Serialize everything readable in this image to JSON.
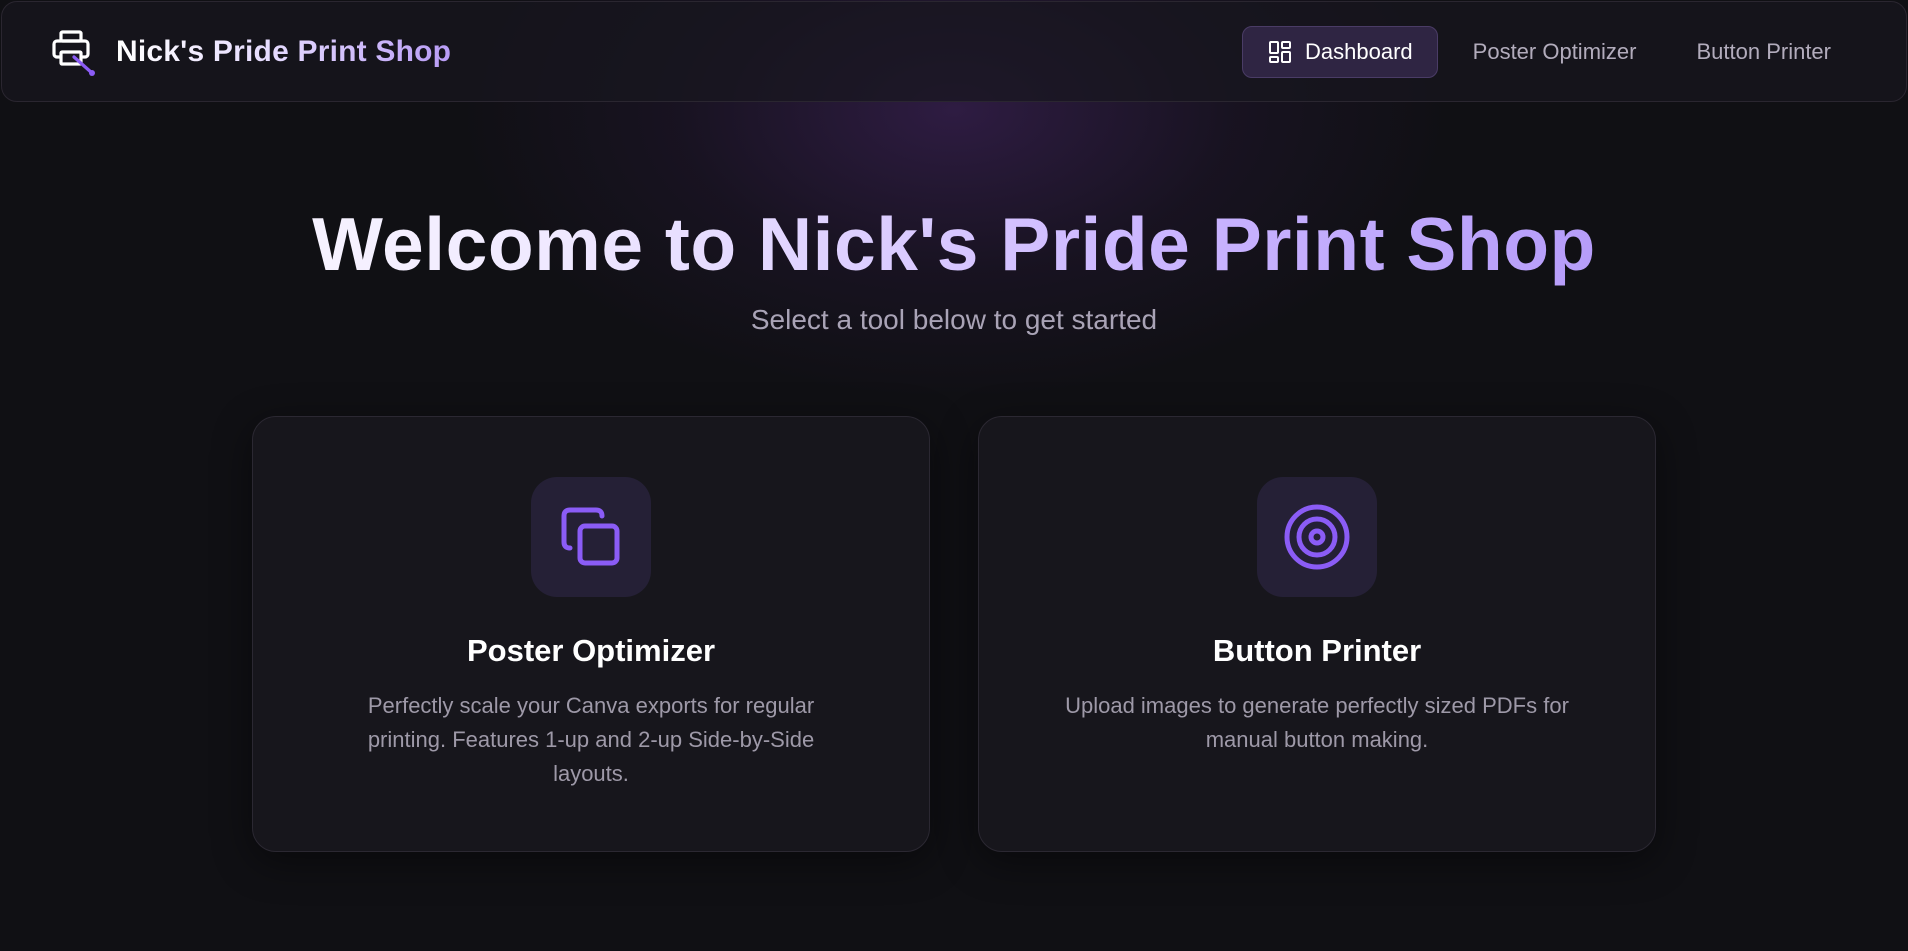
{
  "app": {
    "title_part1": "Nick's Pride ",
    "title_part2": "Print Shop",
    "logo_icon": "printer-icon",
    "accent_color": "#8b5cf6"
  },
  "nav": {
    "items": [
      {
        "label": "Dashboard",
        "icon": "dashboard-grid-icon",
        "active": true
      },
      {
        "label": "Poster Optimizer",
        "active": false
      },
      {
        "label": "Button Printer",
        "active": false
      }
    ]
  },
  "hero": {
    "title": "Welcome to Nick's Pride Print Shop",
    "subtitle": "Select a tool below to get started"
  },
  "tools": [
    {
      "title": "Poster Optimizer",
      "description": "Perfectly scale your Canva exports for regular printing. Features 1-up and 2-up Side-by-Side layouts.",
      "icon": "copy-icon"
    },
    {
      "title": "Button Printer",
      "description": "Upload images to generate perfectly sized PDFs for manual button making.",
      "icon": "target-icon"
    }
  ]
}
